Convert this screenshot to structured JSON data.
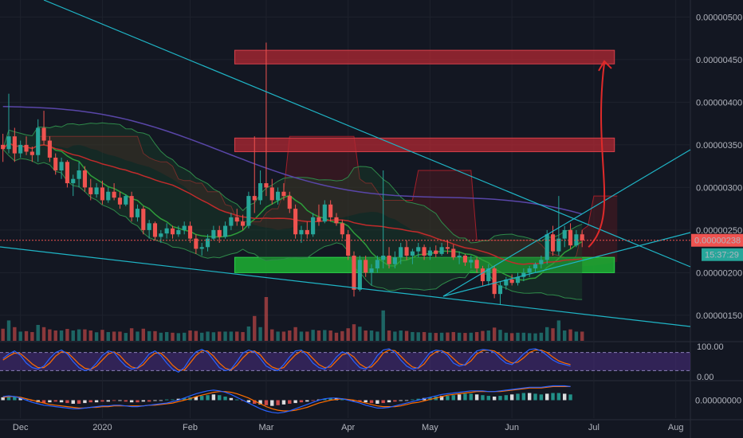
{
  "chart_data": {
    "type": "candlestick",
    "price_scale": {
      "ticks": [
        {
          "value": 5e-06,
          "label": "0.00000500"
        },
        {
          "value": 4.5e-06,
          "label": "0.00000450"
        },
        {
          "value": 4e-06,
          "label": "0.00000400"
        },
        {
          "value": 3.5e-06,
          "label": "0.00000350"
        },
        {
          "value": 3e-06,
          "label": "0.00000300"
        },
        {
          "value": 2.5e-06,
          "label": "0.00000250"
        },
        {
          "value": 2e-06,
          "label": "0.00000200"
        },
        {
          "value": 1.5e-06,
          "label": "0.00000150"
        }
      ],
      "range": [
        1.2e-06,
        5.2e-06
      ]
    },
    "last_price": {
      "value": 2.38e-06,
      "label": "0.00000238",
      "color": "#ef5350"
    },
    "countdown": {
      "label": "15:37:29",
      "color": "#26a69a"
    },
    "resistance_zones": [
      {
        "low": 4.45e-06,
        "high": 4.61e-06,
        "from": 0.34,
        "to": 0.89,
        "color": "#b22833"
      },
      {
        "low": 3.42e-06,
        "high": 3.58e-06,
        "from": 0.34,
        "to": 0.89,
        "color": "#b22833"
      }
    ],
    "support_zone": {
      "low": 2e-06,
      "high": 2.18e-06,
      "from": 0.34,
      "to": 0.89,
      "color": "#1db233"
    },
    "arrow_target": 4.5e-06,
    "candles": [
      [
        3.5e-06,
        3.63e-06,
        3.3e-06,
        3.45e-06
      ],
      [
        3.45e-06,
        4.1e-06,
        3.4e-06,
        3.6e-06
      ],
      [
        3.6e-06,
        3.7e-06,
        3.3e-06,
        3.4e-06
      ],
      [
        3.4e-06,
        3.55e-06,
        3.35e-06,
        3.5e-06
      ],
      [
        3.5e-06,
        3.6e-06,
        3.38e-06,
        3.42e-06
      ],
      [
        3.42e-06,
        3.48e-06,
        3.3e-06,
        3.38e-06
      ],
      [
        3.38e-06,
        3.8e-06,
        3.3e-06,
        3.7e-06
      ],
      [
        3.7e-06,
        3.9e-06,
        3.5e-06,
        3.55e-06
      ],
      [
        3.55e-06,
        3.6e-06,
        3.3e-06,
        3.35e-06
      ],
      [
        3.35e-06,
        3.4e-06,
        3.15e-06,
        3.2e-06
      ],
      [
        3.2e-06,
        3.35e-06,
        3.1e-06,
        3.3e-06
      ],
      [
        3.3e-06,
        3.32e-06,
        3e-06,
        3.05e-06
      ],
      [
        3.05e-06,
        3.15e-06,
        2.9e-06,
        3.1e-06
      ],
      [
        3.1e-06,
        3.3e-06,
        3e-06,
        3.2e-06
      ],
      [
        3.2e-06,
        3.25e-06,
        2.95e-06,
        3e-06
      ],
      [
        3e-06,
        3.1e-06,
        2.85e-06,
        2.92e-06
      ],
      [
        2.92e-06,
        3.05e-06,
        2.88e-06,
        3e-06
      ],
      [
        3e-06,
        3.08e-06,
        2.8e-06,
        2.85e-06
      ],
      [
        2.85e-06,
        3e-06,
        2.82e-06,
        2.95e-06
      ],
      [
        2.95e-06,
        3.05e-06,
        2.85e-06,
        2.88e-06
      ],
      [
        2.88e-06,
        2.95e-06,
        2.75e-06,
        2.8e-06
      ],
      [
        2.8e-06,
        2.92e-06,
        2.78e-06,
        2.9e-06
      ],
      [
        2.9e-06,
        2.95e-06,
        2.6e-06,
        2.65e-06
      ],
      [
        2.65e-06,
        2.8e-06,
        2.6e-06,
        2.75e-06
      ],
      [
        2.75e-06,
        2.78e-06,
        2.45e-06,
        2.5e-06
      ],
      [
        2.5e-06,
        2.62e-06,
        2.4e-06,
        2.58e-06
      ],
      [
        2.58e-06,
        2.6e-06,
        2.38e-06,
        2.42e-06
      ],
      [
        2.42e-06,
        2.5e-06,
        2.35e-06,
        2.46e-06
      ],
      [
        2.46e-06,
        2.58e-06,
        2.4e-06,
        2.52e-06
      ],
      [
        2.52e-06,
        2.55e-06,
        2.4e-06,
        2.45e-06
      ],
      [
        2.45e-06,
        2.55e-06,
        2.42e-06,
        2.5e-06
      ],
      [
        2.5e-06,
        2.6e-06,
        2.45e-06,
        2.55e-06
      ],
      [
        2.55e-06,
        2.6e-06,
        2.35e-06,
        2.4e-06
      ],
      [
        2.4e-06,
        2.45e-06,
        2.22e-06,
        2.28e-06
      ],
      [
        2.28e-06,
        2.35e-06,
        2.2e-06,
        2.3e-06
      ],
      [
        2.3e-06,
        2.45e-06,
        2.25e-06,
        2.4e-06
      ],
      [
        2.4e-06,
        2.55e-06,
        2.38e-06,
        2.5e-06
      ],
      [
        2.5e-06,
        2.55e-06,
        2.35e-06,
        2.42e-06
      ],
      [
        2.42e-06,
        2.6e-06,
        2.4e-06,
        2.55e-06
      ],
      [
        2.55e-06,
        2.7e-06,
        2.5e-06,
        2.65e-06
      ],
      [
        2.65e-06,
        2.75e-06,
        2.55e-06,
        2.6e-06
      ],
      [
        2.6e-06,
        2.68e-06,
        2.5e-06,
        2.55e-06
      ],
      [
        2.55e-06,
        2.95e-06,
        2.52e-06,
        2.9e-06
      ],
      [
        2.9e-06,
        3.6e-06,
        2.7e-06,
        2.85e-06
      ],
      [
        2.85e-06,
        3.2e-06,
        2.8e-06,
        3.05e-06
      ],
      [
        3.05e-06,
        4.7e-06,
        2.9e-06,
        3e-06
      ],
      [
        3e-06,
        3.1e-06,
        2.8e-06,
        2.85e-06
      ],
      [
        2.85e-06,
        3e-06,
        2.8e-06,
        2.95e-06
      ],
      [
        2.95e-06,
        3.05e-06,
        2.85e-06,
        2.9e-06
      ],
      [
        2.9e-06,
        2.95e-06,
        2.7e-06,
        2.75e-06
      ],
      [
        2.75e-06,
        2.8e-06,
        2.4e-06,
        2.45e-06
      ],
      [
        2.45e-06,
        2.55e-06,
        2.35e-06,
        2.5e-06
      ],
      [
        2.5e-06,
        2.6e-06,
        2.4e-06,
        2.45e-06
      ],
      [
        2.45e-06,
        2.7e-06,
        2.42e-06,
        2.65e-06
      ],
      [
        2.65e-06,
        2.8e-06,
        2.55e-06,
        2.6e-06
      ],
      [
        2.6e-06,
        2.85e-06,
        2.58e-06,
        2.8e-06
      ],
      [
        2.8e-06,
        2.85e-06,
        2.6e-06,
        2.65e-06
      ],
      [
        2.65e-06,
        2.7e-06,
        2.55e-06,
        2.58e-06
      ],
      [
        2.58e-06,
        2.62e-06,
        2.4e-06,
        2.45e-06
      ],
      [
        2.45e-06,
        2.5e-06,
        2.15e-06,
        2.2e-06
      ],
      [
        2.2e-06,
        2.25e-06,
        1.72e-06,
        1.8e-06
      ],
      [
        1.8e-06,
        2.2e-06,
        1.78e-06,
        2.15e-06
      ],
      [
        2.15e-06,
        2.2e-06,
        1.95e-06,
        2e-06
      ],
      [
        2e-06,
        2.1e-06,
        1.85e-06,
        2.05e-06
      ],
      [
        2.05e-06,
        2.2e-06,
        2e-06,
        2.15e-06
      ],
      [
        2.15e-06,
        3.2e-06,
        2.05e-06,
        2.2e-06
      ],
      [
        2.2e-06,
        2.3e-06,
        2.05e-06,
        2.1e-06
      ],
      [
        2.1e-06,
        2.25e-06,
        2.05e-06,
        2.18e-06
      ],
      [
        2.18e-06,
        2.35e-06,
        2.1e-06,
        2.3e-06
      ],
      [
        2.3e-06,
        2.38e-06,
        2.15e-06,
        2.2e-06
      ],
      [
        2.2e-06,
        2.28e-06,
        2.1e-06,
        2.25e-06
      ],
      [
        2.25e-06,
        2.35e-06,
        2.18e-06,
        2.3e-06
      ],
      [
        2.3e-06,
        2.33e-06,
        2.15e-06,
        2.2e-06
      ],
      [
        2.2e-06,
        2.3e-06,
        2.15e-06,
        2.26e-06
      ],
      [
        2.26e-06,
        2.32e-06,
        2.18e-06,
        2.22e-06
      ],
      [
        2.22e-06,
        2.35e-06,
        2.2e-06,
        2.3e-06
      ],
      [
        2.3e-06,
        2.38e-06,
        2.22e-06,
        2.28e-06
      ],
      [
        2.28e-06,
        2.33e-06,
        2.15e-06,
        2.18e-06
      ],
      [
        2.18e-06,
        2.25e-06,
        2.1e-06,
        2.2e-06
      ],
      [
        2.2e-06,
        2.22e-06,
        2.08e-06,
        2.12e-06
      ],
      [
        2.12e-06,
        2.2e-06,
        2.05e-06,
        2.15e-06
      ],
      [
        2.15e-06,
        2.18e-06,
        2e-06,
        2.05e-06
      ],
      [
        2.05e-06,
        2.08e-06,
        1.85e-06,
        1.9e-06
      ],
      [
        1.9e-06,
        2.1e-06,
        1.85e-06,
        2.05e-06
      ],
      [
        2.05e-06,
        2.08e-06,
        1.7e-06,
        1.75e-06
      ],
      [
        1.75e-06,
        1.9e-06,
        1.62e-06,
        1.85e-06
      ],
      [
        1.85e-06,
        1.95e-06,
        1.8e-06,
        1.92e-06
      ],
      [
        1.92e-06,
        1.98e-06,
        1.85e-06,
        1.88e-06
      ],
      [
        1.88e-06,
        2e-06,
        1.85e-06,
        1.95e-06
      ],
      [
        1.95e-06,
        2.05e-06,
        1.9e-06,
        2e-06
      ],
      [
        2e-06,
        2.08e-06,
        1.95e-06,
        2.05e-06
      ],
      [
        2.05e-06,
        2.12e-06,
        2e-06,
        2.1e-06
      ],
      [
        2.1e-06,
        2.2e-06,
        2.05e-06,
        2.15e-06
      ],
      [
        2.15e-06,
        2.5e-06,
        2.1e-06,
        2.45e-06
      ],
      [
        2.45e-06,
        2.55e-06,
        2.2e-06,
        2.25e-06
      ],
      [
        2.25e-06,
        2.9e-06,
        2.2e-06,
        2.4e-06
      ],
      [
        2.4e-06,
        2.55e-06,
        2.3e-06,
        2.5e-06
      ],
      [
        2.5e-06,
        2.58e-06,
        2.28e-06,
        2.32e-06
      ],
      [
        2.32e-06,
        2.5e-06,
        2.3e-06,
        2.45e-06
      ],
      [
        2.45e-06,
        2.5e-06,
        2.3e-06,
        2.38e-06
      ]
    ],
    "x_axis": {
      "labels": [
        {
          "label": "Dec",
          "index": 3
        },
        {
          "label": "2020",
          "index": 17
        },
        {
          "label": "Feb",
          "index": 32
        },
        {
          "label": "Mar",
          "index": 45
        },
        {
          "label": "Apr",
          "index": 59
        },
        {
          "label": "May",
          "index": 73
        },
        {
          "label": "Jun",
          "index": 87
        },
        {
          "label": "Jul",
          "index": 101
        },
        {
          "label": "Aug",
          "index": 115
        }
      ],
      "total_slots": 118
    },
    "stoch_rsi": {
      "ticks": [
        {
          "value": 100,
          "label": "100.00"
        },
        {
          "value": 0,
          "label": "0.00"
        }
      ],
      "bands": [
        80,
        20
      ],
      "k": [
        60,
        75,
        85,
        70,
        45,
        30,
        25,
        35,
        60,
        80,
        88,
        75,
        50,
        30,
        20,
        25,
        45,
        70,
        85,
        80,
        55,
        35,
        25,
        30,
        50,
        75,
        85,
        70,
        45,
        25,
        15,
        30,
        60,
        82,
        90,
        80,
        55,
        30,
        20,
        25,
        50,
        78,
        88,
        82,
        60,
        35,
        25,
        20,
        40,
        65,
        85,
        88,
        70,
        45,
        30,
        25,
        40,
        65,
        82,
        75,
        50,
        30,
        25,
        40,
        70,
        88,
        92,
        80,
        55,
        35,
        25,
        30,
        55,
        80,
        88,
        85,
        70,
        45,
        35,
        40,
        65,
        85,
        90,
        88,
        80,
        60,
        45,
        40,
        55,
        75,
        90,
        92,
        85,
        70,
        55,
        45,
        40,
        35
      ],
      "d": [
        55,
        68,
        78,
        76,
        60,
        42,
        30,
        30,
        45,
        68,
        82,
        80,
        62,
        42,
        28,
        24,
        35,
        55,
        75,
        82,
        70,
        48,
        32,
        28,
        40,
        62,
        78,
        78,
        60,
        38,
        22,
        22,
        45,
        70,
        85,
        85,
        68,
        45,
        28,
        22,
        38,
        62,
        80,
        85,
        72,
        48,
        32,
        25,
        30,
        52,
        72,
        85,
        80,
        60,
        40,
        30,
        32,
        52,
        72,
        78,
        65,
        42,
        30,
        32,
        52,
        78,
        88,
        86,
        68,
        48,
        32,
        28,
        42,
        68,
        82,
        86,
        78,
        60,
        42,
        38,
        52,
        75,
        86,
        88,
        85,
        72,
        55,
        45,
        48,
        62,
        80,
        88,
        88,
        80,
        65,
        52,
        45,
        40
      ]
    },
    "macd": {
      "ticks": [
        {
          "value": 0,
          "label": "0.00000000"
        }
      ],
      "hist": [
        0.4,
        0.6,
        0.5,
        0.3,
        0.1,
        -0.1,
        -0.3,
        -0.4,
        -0.3,
        -0.2,
        -0.3,
        -0.4,
        -0.5,
        -0.5,
        -0.4,
        -0.3,
        -0.3,
        -0.2,
        -0.2,
        -0.1,
        -0.1,
        -0.2,
        -0.3,
        -0.3,
        -0.2,
        -0.2,
        -0.1,
        0.0,
        0.1,
        0.1,
        0.2,
        0.3,
        0.4,
        0.5,
        0.6,
        0.7,
        0.8,
        0.7,
        0.5,
        0.3,
        0.1,
        -0.1,
        -0.3,
        -0.5,
        -0.6,
        -0.7,
        -0.8,
        -0.7,
        -0.6,
        -0.5,
        -0.4,
        -0.3,
        -0.2,
        -0.1,
        0.1,
        0.2,
        0.3,
        0.3,
        0.2,
        0.1,
        -0.1,
        -0.2,
        -0.3,
        -0.4,
        -0.5,
        -0.4,
        -0.3,
        -0.2,
        -0.1,
        0.0,
        0.1,
        0.2,
        0.3,
        0.4,
        0.5,
        0.6,
        0.6,
        0.7,
        0.8,
        0.9,
        0.9,
        0.8,
        0.7,
        0.6,
        0.5,
        0.6,
        0.7,
        0.8,
        0.9,
        1.0,
        1.0,
        0.9,
        0.8,
        0.9,
        1.0,
        1.0,
        0.9,
        0.8
      ],
      "macd_line": [
        0.5,
        0.6,
        0.5,
        0.3,
        0.0,
        -0.3,
        -0.5,
        -0.7,
        -0.8,
        -0.9,
        -1.0,
        -1.1,
        -1.2,
        -1.2,
        -1.1,
        -1.0,
        -0.9,
        -0.8,
        -0.8,
        -0.7,
        -0.7,
        -0.8,
        -0.9,
        -0.9,
        -0.8,
        -0.7,
        -0.6,
        -0.5,
        -0.4,
        -0.2,
        0.0,
        0.3,
        0.6,
        0.9,
        1.1,
        1.3,
        1.4,
        1.3,
        1.1,
        0.8,
        0.4,
        0.0,
        -0.4,
        -0.8,
        -1.2,
        -1.5,
        -1.7,
        -1.8,
        -1.7,
        -1.5,
        -1.2,
        -0.9,
        -0.6,
        -0.3,
        0.0,
        0.2,
        0.3,
        0.3,
        0.2,
        0.0,
        -0.2,
        -0.4,
        -0.7,
        -0.9,
        -1.1,
        -1.1,
        -1.0,
        -0.8,
        -0.6,
        -0.4,
        -0.2,
        0.0,
        0.2,
        0.4,
        0.6,
        0.8,
        0.9,
        1.0,
        1.1,
        1.2,
        1.3,
        1.3,
        1.3,
        1.2,
        1.2,
        1.3,
        1.4,
        1.5,
        1.6,
        1.7,
        1.8,
        1.8,
        1.8,
        1.9,
        2.0,
        2.0,
        2.0,
        1.9
      ],
      "signal_line": [
        0.4,
        0.5,
        0.5,
        0.4,
        0.2,
        0.0,
        -0.2,
        -0.4,
        -0.6,
        -0.7,
        -0.8,
        -0.9,
        -1.0,
        -1.1,
        -1.1,
        -1.0,
        -1.0,
        -0.9,
        -0.9,
        -0.8,
        -0.8,
        -0.8,
        -0.8,
        -0.8,
        -0.8,
        -0.7,
        -0.7,
        -0.6,
        -0.5,
        -0.4,
        -0.2,
        0.0,
        0.2,
        0.5,
        0.7,
        0.9,
        1.1,
        1.2,
        1.2,
        1.1,
        0.9,
        0.6,
        0.3,
        -0.1,
        -0.5,
        -0.9,
        -1.2,
        -1.4,
        -1.5,
        -1.5,
        -1.4,
        -1.2,
        -1.0,
        -0.7,
        -0.4,
        -0.2,
        0.0,
        0.1,
        0.2,
        0.1,
        0.0,
        -0.2,
        -0.4,
        -0.6,
        -0.8,
        -0.9,
        -0.9,
        -0.9,
        -0.8,
        -0.6,
        -0.4,
        -0.3,
        -0.1,
        0.1,
        0.3,
        0.5,
        0.7,
        0.8,
        0.9,
        1.0,
        1.1,
        1.2,
        1.2,
        1.2,
        1.2,
        1.2,
        1.3,
        1.4,
        1.5,
        1.6,
        1.7,
        1.7,
        1.7,
        1.8,
        1.9,
        1.9,
        1.9,
        1.9
      ]
    },
    "colors": {
      "background": "#131722",
      "up": "#26a69a",
      "down": "#ef5350",
      "trendline": "#1fb5c6",
      "ma_fast": "#2e9e3a",
      "ma_mid": "#c12b2b",
      "ma_slow": "#5946a8",
      "arrow": "#e02a2a",
      "stoch_k": "#2962ff",
      "stoch_d": "#ff6d00",
      "stoch_band": "#4a2d82"
    }
  }
}
